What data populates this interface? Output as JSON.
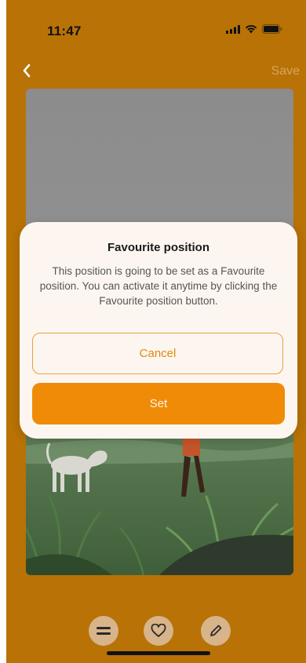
{
  "status_bar": {
    "time": "11:47",
    "icons": [
      "signal-icon",
      "wifi-icon",
      "battery-icon"
    ]
  },
  "nav": {
    "back_icon": "chevron-left-icon",
    "save_label": "Save"
  },
  "modal": {
    "title": "Favourite position",
    "body": "This position is going to be set as a Favourite position. You can activate it anytime by clicking the Favourite position button.",
    "cancel_label": "Cancel",
    "set_label": "Set"
  },
  "toolbar": {
    "items": [
      "equals-icon",
      "heart-icon",
      "pencil-icon"
    ]
  },
  "colors": {
    "background": "#b87206",
    "accent": "#ef8b06",
    "modal_bg": "#fdf6f0"
  }
}
